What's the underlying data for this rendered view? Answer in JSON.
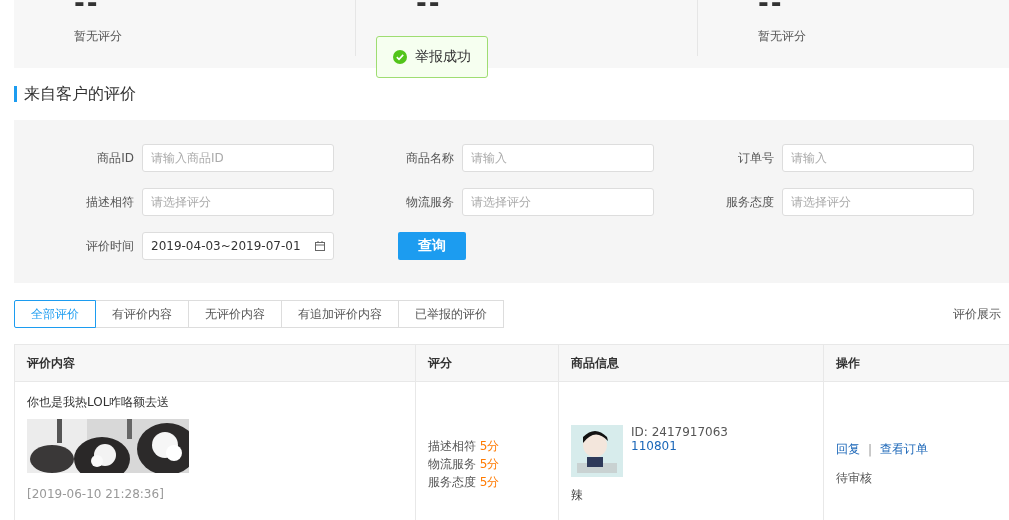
{
  "stats": [
    {
      "value": "--",
      "label": "暂无评分"
    },
    {
      "value": "--"
    },
    {
      "value": "--",
      "label": "暂无评分"
    }
  ],
  "toast": {
    "text": "举报成功"
  },
  "section_title": "来自客户的评价",
  "filters": [
    {
      "kind": "input",
      "label": "商品ID",
      "placeholder": "请输入商品ID"
    },
    {
      "kind": "input",
      "label": "商品名称",
      "placeholder": "请输入"
    },
    {
      "kind": "input",
      "label": "订单号",
      "placeholder": "请输入"
    },
    {
      "kind": "input",
      "label": "描述相符",
      "placeholder": "请选择评分"
    },
    {
      "kind": "input",
      "label": "物流服务",
      "placeholder": "请选择评分"
    },
    {
      "kind": "input",
      "label": "服务态度",
      "placeholder": "请选择评分"
    },
    {
      "kind": "date",
      "label": "评价时间",
      "value": "2019-04-03~2019-07-01"
    }
  ],
  "query_button": "查询",
  "tabs": [
    {
      "label": "全部评价",
      "selected": true
    },
    {
      "label": "有评价内容",
      "selected": false
    },
    {
      "label": "无评价内容",
      "selected": false
    },
    {
      "label": "有追加评价内容",
      "selected": false
    },
    {
      "label": "已举报的评价",
      "selected": false
    }
  ],
  "rules_link": "评价展示",
  "table": {
    "columns": [
      "评价内容",
      "评分",
      "商品信息",
      "操作"
    ],
    "rows": [
      {
        "review": {
          "text": "你也是我热LOL咋咯额去送",
          "time": "[2019-06-10 21:28:36]"
        },
        "ratings": [
          {
            "label": "描述相符",
            "score": "5分"
          },
          {
            "label": "物流服务",
            "score": "5分"
          },
          {
            "label": "服务态度",
            "score": "5分"
          }
        ],
        "product": {
          "id": "ID: 2417917063",
          "code": "110801",
          "name": "辣"
        },
        "actions": {
          "reply": "回复",
          "separator": "|",
          "view_order": "查看订单",
          "status": "待审核"
        }
      }
    ]
  }
}
